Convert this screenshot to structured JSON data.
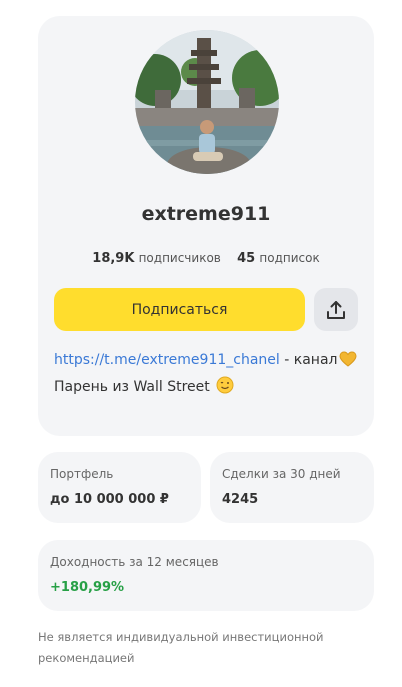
{
  "profile": {
    "username": "extreme911",
    "subscribers_count": "18,9K",
    "subscribers_label": "подписчиков",
    "subscriptions_count": "45",
    "subscriptions_label": "подписок",
    "subscribe_label": "Подписаться",
    "share_icon": "share-upload-icon",
    "avatar_icon": "profile-photo"
  },
  "bio": {
    "link_text": "https://t.me/extreme911_chanel",
    "line1_suffix": " - канал",
    "line2": "Парень из Wall Street ",
    "emoji1": "heart-emoji",
    "emoji2": "smile-emoji"
  },
  "stats": {
    "portfolio": {
      "label": "Портфель",
      "value": "до 10 000 000 ₽"
    },
    "deals": {
      "label": "Сделки за 30 дней",
      "value": "4245"
    },
    "yield": {
      "label": "Доходность за 12 месяцев",
      "value": "+180,99%"
    }
  },
  "disclaimer": "Не является индивидуальной инвестиционной рекомендацией",
  "colors": {
    "accent_yellow": "#ffdd2d",
    "link_blue": "#3a79d6",
    "positive_green": "#27a046",
    "card_bg": "#f4f5f7"
  }
}
